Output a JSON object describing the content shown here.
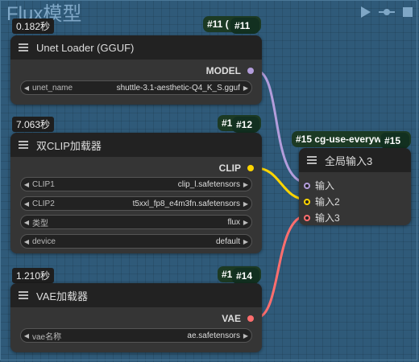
{
  "group": {
    "title": "Flux模型"
  },
  "toolbar": {
    "icons": [
      "play-icon",
      "link-icon",
      "square-icon"
    ]
  },
  "nodes": {
    "unet": {
      "timing": "0.182秒",
      "badge_outer": "#11 (",
      "badge_inner": "#11",
      "title": "Unet Loader (GGUF)",
      "output": "MODEL",
      "output_color": "#b39ddb",
      "widgets": [
        {
          "label": "unet_name",
          "value": "shuttle-3.1-aesthetic-Q4_K_S.gguf"
        }
      ]
    },
    "clip": {
      "timing": "7.063秒",
      "badge_outer": "#1",
      "badge_inner": "#12",
      "title": "双CLIP加载器",
      "output": "CLIP",
      "output_color": "#ffd500",
      "widgets": [
        {
          "label": "CLIP1",
          "value": "clip_l.safetensors"
        },
        {
          "label": "CLIP2",
          "value": "t5xxl_fp8_e4m3fn.safetensors"
        },
        {
          "label": "类型",
          "value": "flux"
        },
        {
          "label": "device",
          "value": "default"
        }
      ]
    },
    "vae": {
      "timing": "1.210秒",
      "badge_outer": "#1",
      "badge_inner": "#14",
      "title": "VAE加载器",
      "output": "VAE",
      "output_color": "#ff6e6e",
      "widgets": [
        {
          "label": "vae名称",
          "value": "ae.safetensors"
        }
      ]
    },
    "global": {
      "badge_outer": "#15 cg-use-everyw",
      "badge_inner": "#15",
      "title": "全局输入3",
      "inputs": [
        {
          "label": "输入",
          "color": "#b39ddb"
        },
        {
          "label": "输入2",
          "color": "#ffd500"
        },
        {
          "label": "输入3",
          "color": "#ff6e6e"
        }
      ]
    }
  },
  "colors": {
    "canvas": "#2f5a79",
    "node_body": "#353535",
    "node_title": "#222222",
    "badge": "#1c3a24"
  }
}
